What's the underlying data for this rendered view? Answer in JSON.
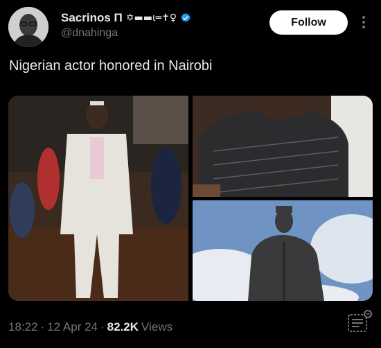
{
  "author": {
    "display_name": "Sacrinos Π",
    "name_emoji": "✡▬▬ι═✝♀",
    "handle": "@dnahinga",
    "avatar_icon": "avatar-photo",
    "verified_icon": "verified-badge-icon",
    "verified_color": "#1d9bf0"
  },
  "actions": {
    "follow_label": "Follow",
    "more_icon": "more-vertical-icon"
  },
  "tweet": {
    "text": "Nigerian actor honored in Nairobi"
  },
  "media": {
    "count": 3,
    "images": [
      "photo-man-in-white-suit",
      "photo-man-in-patterned-shirt",
      "photo-seated-statue"
    ]
  },
  "meta": {
    "time": "18:22",
    "sep1": "·",
    "date": "12 Apr 24",
    "sep2": "·",
    "views_count": "82.2K",
    "views_label": "Views"
  },
  "colors": {
    "background": "#000000",
    "text": "#e7e9ea",
    "secondary": "#71767b",
    "follow_bg": "#ffffff"
  }
}
